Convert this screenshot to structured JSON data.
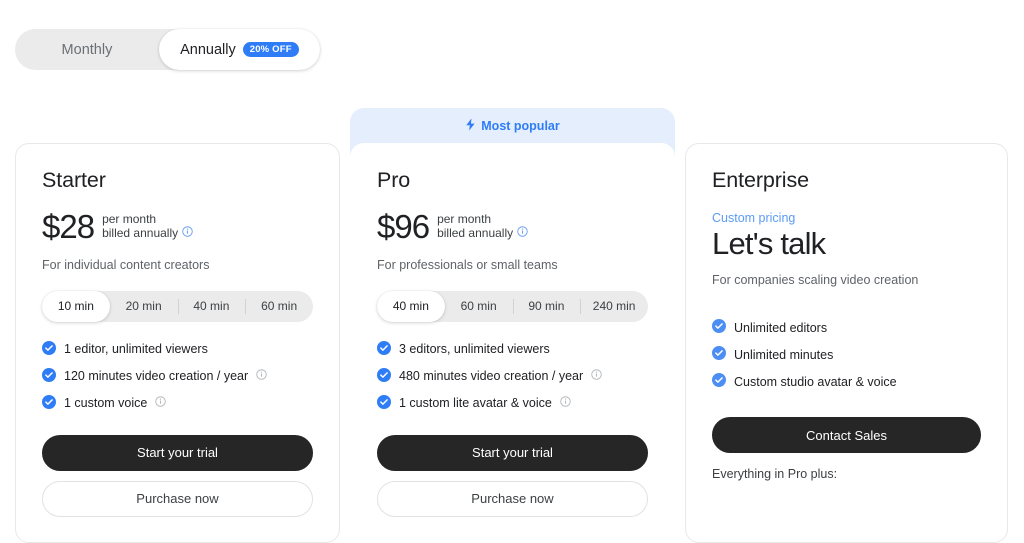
{
  "billing_toggle": {
    "options": [
      {
        "label": "Monthly",
        "active": false,
        "badge": null
      },
      {
        "label": "Annually",
        "active": true,
        "badge": "20% OFF"
      }
    ],
    "badge_color": "#2f7df6"
  },
  "plans": [
    {
      "id": "starter",
      "name": "Starter",
      "highlight": null,
      "price_amount": "$28",
      "price_period": "per month",
      "price_billing": "billed annually",
      "price_info_icon": "info-icon",
      "tagline": "For individual content creators",
      "durations": [
        {
          "label": "10 min",
          "active": true
        },
        {
          "label": "20 min",
          "active": false
        },
        {
          "label": "40 min",
          "active": false
        },
        {
          "label": "60 min",
          "active": false
        }
      ],
      "features": [
        {
          "text": "1 editor, unlimited viewers",
          "info": false
        },
        {
          "text": "120 minutes video creation / year",
          "info": true
        },
        {
          "text": "1 custom voice",
          "info": true
        }
      ],
      "primary_button": "Start your trial",
      "secondary_button": "Purchase now",
      "footer_note": null
    },
    {
      "id": "pro",
      "name": "Pro",
      "highlight": "Most popular",
      "highlight_icon": "bolt-icon",
      "price_amount": "$96",
      "price_period": "per month",
      "price_billing": "billed annually",
      "price_info_icon": "info-icon",
      "tagline": "For professionals or small teams",
      "durations": [
        {
          "label": "40 min",
          "active": true
        },
        {
          "label": "60 min",
          "active": false
        },
        {
          "label": "90 min",
          "active": false
        },
        {
          "label": "240 min",
          "active": false
        }
      ],
      "features": [
        {
          "text": "3 editors, unlimited viewers",
          "info": false
        },
        {
          "text": "480 minutes video creation / year",
          "info": true
        },
        {
          "text": "1 custom lite avatar & voice",
          "info": true
        }
      ],
      "primary_button": "Start your trial",
      "secondary_button": "Purchase now",
      "footer_note": null
    },
    {
      "id": "enterprise",
      "name": "Enterprise",
      "highlight": null,
      "custom_pricing_label": "Custom pricing",
      "custom_pricing_color": "#5b9bf5",
      "price_amount": "Let's talk",
      "tagline": "For companies scaling video creation",
      "durations": [],
      "features": [
        {
          "text": "Unlimited editors",
          "info": false
        },
        {
          "text": "Unlimited minutes",
          "info": false
        },
        {
          "text": "Custom studio avatar & voice",
          "info": false
        }
      ],
      "primary_button": "Contact Sales",
      "secondary_button": null,
      "footer_note": "Everything in Pro plus:"
    }
  ],
  "colors": {
    "accent_blue": "#2f7df6",
    "check_blue": "#2f7df6",
    "button_dark": "#262626",
    "popular_bg": "#e4eefc"
  }
}
